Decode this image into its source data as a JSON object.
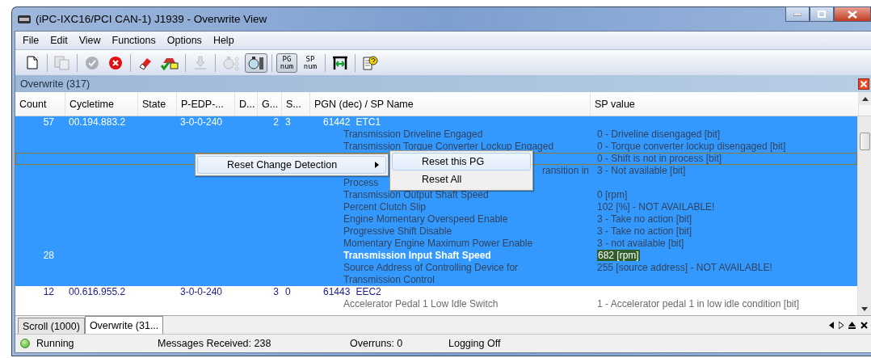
{
  "window": {
    "title": "(iPC-IXC16/PCI  CAN-1) J1939 - Overwrite View"
  },
  "menu": [
    "File",
    "Edit",
    "View",
    "Functions",
    "Options",
    "Help"
  ],
  "toolbar": [
    {
      "kind": "new",
      "disabled": false,
      "pressed": false
    },
    {
      "kind": "sep"
    },
    {
      "kind": "copy",
      "disabled": true,
      "pressed": false
    },
    {
      "kind": "sep"
    },
    {
      "kind": "check",
      "disabled": true,
      "pressed": false
    },
    {
      "kind": "stop",
      "disabled": false,
      "pressed": false
    },
    {
      "kind": "sep"
    },
    {
      "kind": "erase",
      "disabled": false,
      "pressed": false
    },
    {
      "kind": "car",
      "disabled": false,
      "pressed": false
    },
    {
      "kind": "sep"
    },
    {
      "kind": "import",
      "disabled": true,
      "pressed": false
    },
    {
      "kind": "sep"
    },
    {
      "kind": "watch",
      "disabled": true,
      "pressed": false
    },
    {
      "kind": "watch-rel",
      "disabled": false,
      "pressed": true
    },
    {
      "kind": "sep"
    },
    {
      "kind": "text",
      "top": "PG",
      "bottom": "num",
      "disabled": false,
      "pressed": true
    },
    {
      "kind": "text",
      "top": "SP",
      "bottom": "num",
      "disabled": false,
      "pressed": false
    },
    {
      "kind": "sep"
    },
    {
      "kind": "fit",
      "disabled": false,
      "pressed": false
    },
    {
      "kind": "sep"
    },
    {
      "kind": "help",
      "disabled": false,
      "pressed": false
    }
  ],
  "panel": {
    "title": "Overwrite (317)"
  },
  "table": {
    "columns": [
      "Count",
      "Cycletime",
      "State",
      "P-EDP-...",
      "D...",
      "G...",
      "S...",
      "PGN (dec) / SP Name",
      "SP value"
    ],
    "rows": [
      {
        "kind": "pg",
        "count": "57",
        "cycletime": "00.194.883.2",
        "p_edp": "3-0-0-240",
        "g": "2",
        "s": "3",
        "pgn": "61442",
        "pg_name": "ETC1",
        "selected": true
      },
      {
        "kind": "signal",
        "name": "Transmission Driveline Engaged",
        "value": "0 - Driveline disengaged [bit]",
        "selected": true,
        "focused": false,
        "changed": false
      },
      {
        "kind": "signal",
        "name": "Transmission Torque Converter Lockup Engaged",
        "value": "0 - Torque converter lockup disengaged [bit]",
        "selected": true,
        "focused": false,
        "changed": false
      },
      {
        "kind": "signal",
        "value": "0 - Shift is not in process [bit]",
        "selected": true,
        "focused": true,
        "changed": false
      },
      {
        "kind": "covered",
        "name_lines": [
          "ransition in",
          "Process"
        ],
        "value": "3 - Not available [bit]",
        "selected": true,
        "focused": false,
        "changed": false
      },
      {
        "kind": "signal",
        "name": "Transmission Output Shaft Speed",
        "value": "0 [rpm]",
        "selected": true,
        "focused": false,
        "changed": false
      },
      {
        "kind": "signal",
        "name": "Percent Clutch Slip",
        "value": "102 [%] - NOT AVAILABLE!",
        "selected": true,
        "focused": false,
        "changed": false
      },
      {
        "kind": "signal",
        "name": "Engine Momentary Overspeed Enable",
        "value": "3 - Take no action [bit]",
        "selected": true,
        "focused": false,
        "changed": false
      },
      {
        "kind": "signal",
        "name": "Progressive Shift Disable",
        "value": "3 - Take no action [bit]",
        "selected": true,
        "focused": false,
        "changed": false
      },
      {
        "kind": "signal",
        "name": "Momentary Engine Maximum Power Enable",
        "value": "3 - not available [bit]",
        "selected": true,
        "focused": false,
        "changed": false
      },
      {
        "kind": "signal",
        "count": "28",
        "name": "Transmission Input Shaft Speed",
        "value": "682 [rpm]",
        "selected": true,
        "focused": false,
        "changed": true
      },
      {
        "kind": "signal",
        "name": "Source Address of Controlling Device for Transmission Control",
        "value": "255 [source address] - NOT AVAILABLE!",
        "selected": true,
        "focused": false,
        "changed": false
      },
      {
        "kind": "pg",
        "count": "12",
        "cycletime": "00.616.955.2",
        "p_edp": "3-0-0-240",
        "g": "3",
        "s": "0",
        "pgn": "61443",
        "pg_name": "EEC2",
        "selected": false
      },
      {
        "kind": "signal",
        "name": "Accelerator Pedal 1 Low Idle Switch",
        "value": "1 - Accelerator pedal 1 in low idle condition [bit]",
        "selected": false,
        "focused": false,
        "changed": false
      }
    ]
  },
  "context_menu": {
    "items": [
      {
        "label": "Reset Change Detection",
        "selected": true
      }
    ],
    "submenu": [
      {
        "label": "Reset this PG",
        "selected": true
      },
      {
        "label": "Reset All",
        "selected": false
      }
    ]
  },
  "tabs": [
    {
      "label": "Scroll (1000)",
      "selected": false
    },
    {
      "label": "Overwrite (31...",
      "selected": true
    }
  ],
  "status_bar": {
    "state": "Running",
    "running": true,
    "messages": "Messages Received: 238",
    "overruns": "Overruns: 0",
    "logging": "Logging Off"
  }
}
